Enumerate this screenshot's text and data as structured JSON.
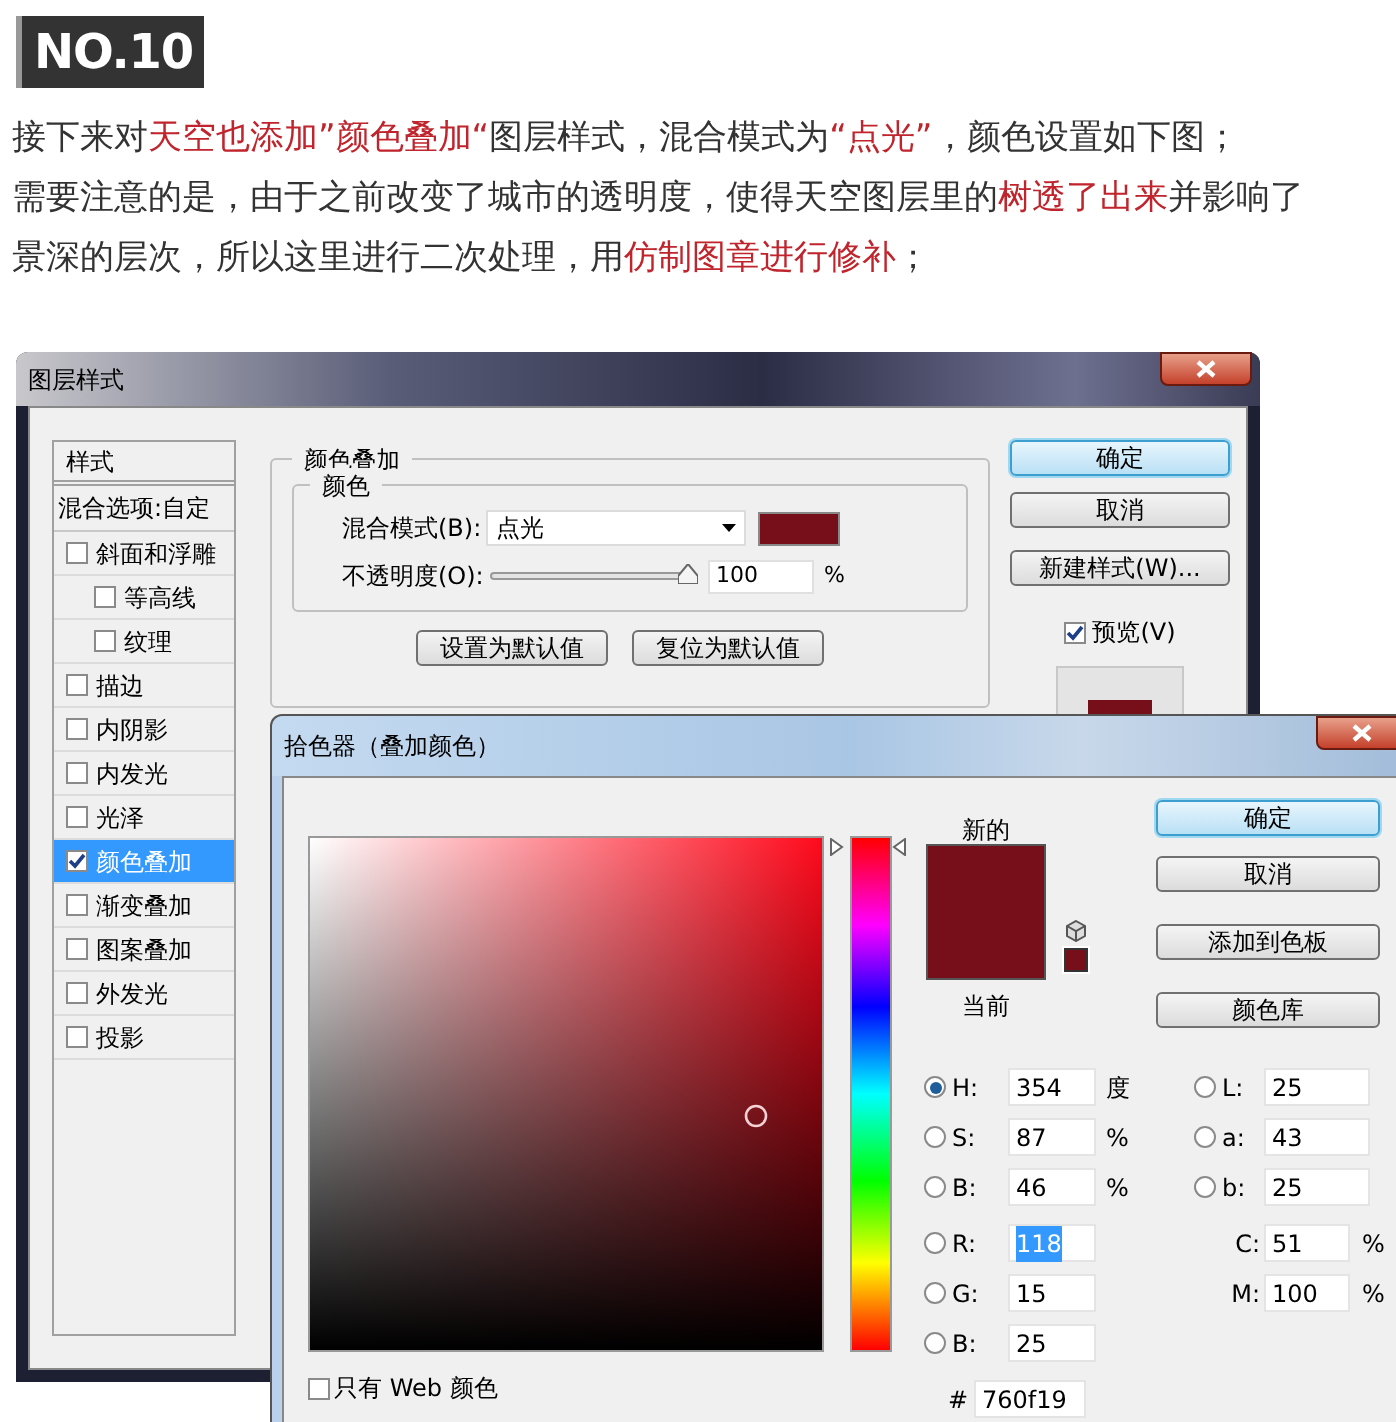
{
  "heading": "NO.10",
  "paragraph": [
    [
      {
        "text": "接下来对",
        "highlight": false
      },
      {
        "text": "天空也添加”颜色叠加“",
        "highlight": true
      },
      {
        "text": "图层样式，混合模式为",
        "highlight": false
      },
      {
        "text": "“点光”",
        "highlight": true
      },
      {
        "text": "，颜色设置如下图；",
        "highlight": false
      }
    ],
    [
      {
        "text": "需要注意的是，由于之前改变了城市的透明度，使得天空图层里的",
        "highlight": false
      },
      {
        "text": "树透了出来",
        "highlight": true
      },
      {
        "text": "并影响了",
        "highlight": false
      }
    ],
    [
      {
        "text": "景深的层次，所以这里进行二次处理，用",
        "highlight": false
      },
      {
        "text": "仿制图章进行修补",
        "highlight": true
      },
      {
        "text": "；",
        "highlight": false
      }
    ]
  ],
  "layer_style_dialog": {
    "title": "图层样式",
    "styles_header": "样式",
    "blend_options": "混合选项:自定",
    "styles": [
      {
        "label": "斜面和浮雕",
        "checked": false,
        "selected": false,
        "children": [
          {
            "label": "等高线",
            "checked": false,
            "selected": false
          },
          {
            "label": "纹理",
            "checked": false,
            "selected": false
          }
        ]
      },
      {
        "label": "描边",
        "checked": false,
        "selected": false
      },
      {
        "label": "内阴影",
        "checked": false,
        "selected": false
      },
      {
        "label": "内发光",
        "checked": false,
        "selected": false
      },
      {
        "label": "光泽",
        "checked": false,
        "selected": false
      },
      {
        "label": "颜色叠加",
        "checked": true,
        "selected": true
      },
      {
        "label": "渐变叠加",
        "checked": false,
        "selected": false
      },
      {
        "label": "图案叠加",
        "checked": false,
        "selected": false
      },
      {
        "label": "外发光",
        "checked": false,
        "selected": false
      },
      {
        "label": "投影",
        "checked": false,
        "selected": false
      }
    ],
    "section_title": "颜色叠加",
    "group_title": "颜色",
    "blend_mode_label": "混合模式(B):",
    "blend_mode": "点光",
    "opacity_label": "不透明度(O):",
    "opacity": {
      "level": 1,
      "value": "100",
      "unit": "%"
    },
    "reset_buttons": [
      "设置为默认值",
      "复位为默认值"
    ],
    "side_buttons": [
      {
        "label": "确定",
        "default": true
      },
      {
        "label": "取消",
        "default": false
      },
      {
        "label": "新建样式(W)...",
        "default": false
      }
    ],
    "preview": {
      "label": "预览(V)",
      "checked": true
    }
  },
  "color_picker": {
    "title": "拾色器（叠加颜色）",
    "new_label": "新的",
    "current_label": "当前",
    "hue_slider": {
      "level": 0.98
    },
    "buttons": [
      {
        "label": "确定",
        "default": true
      },
      {
        "label": "取消",
        "default": false
      },
      {
        "label": "添加到色板",
        "default": false
      },
      {
        "label": "颜色库",
        "default": false
      }
    ],
    "hsb_rgb": [
      {
        "label": "H:",
        "value": "354",
        "unit": "度",
        "selected": true,
        "text_selected": false
      },
      {
        "label": "S:",
        "value": "87",
        "unit": "%",
        "selected": false,
        "text_selected": false
      },
      {
        "label": "B:",
        "value": "46",
        "unit": "%",
        "selected": false,
        "text_selected": false
      },
      {
        "label": "R:",
        "value": "118",
        "selected": false,
        "text_selected": true
      },
      {
        "label": "G:",
        "value": "15",
        "selected": false,
        "text_selected": false
      },
      {
        "label": "B:",
        "value": "25",
        "selected": false,
        "text_selected": false
      }
    ],
    "lab": [
      {
        "label": "L:",
        "value": "25",
        "selected": false
      },
      {
        "label": "a:",
        "value": "43",
        "selected": false
      },
      {
        "label": "b:",
        "value": "25",
        "selected": false
      }
    ],
    "cmyk": [
      {
        "label": "C:",
        "value": "51",
        "unit": "%"
      },
      {
        "label": "M:",
        "value": "100",
        "unit": "%"
      }
    ],
    "hex_label": "#",
    "hex": "760f19",
    "web_only": {
      "label": "只有 Web 颜色",
      "checked": false
    }
  }
}
